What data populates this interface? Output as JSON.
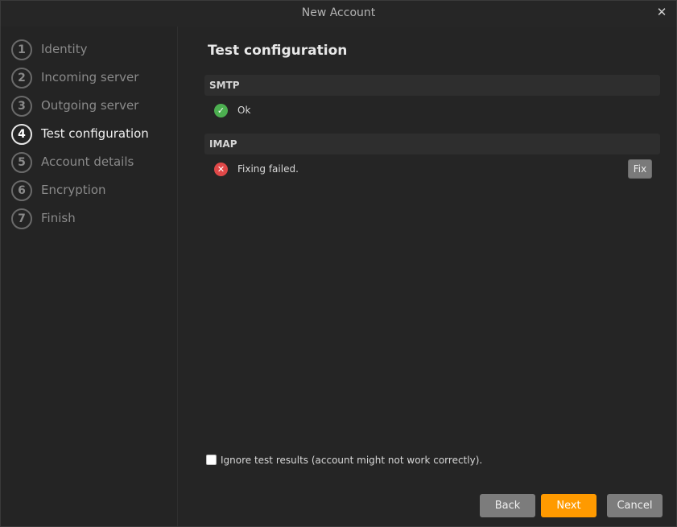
{
  "window": {
    "title": "New Account"
  },
  "steps": [
    {
      "number": "1",
      "label": "Identity"
    },
    {
      "number": "2",
      "label": "Incoming server"
    },
    {
      "number": "3",
      "label": "Outgoing server"
    },
    {
      "number": "4",
      "label": "Test configuration"
    },
    {
      "number": "5",
      "label": "Account details"
    },
    {
      "number": "6",
      "label": "Encryption"
    },
    {
      "number": "7",
      "label": "Finish"
    }
  ],
  "active_step": 3,
  "main": {
    "title": "Test configuration",
    "smtp": {
      "header": "SMTP",
      "status_text": "Ok",
      "status": "ok"
    },
    "imap": {
      "header": "IMAP",
      "status_text": "Fixing failed.",
      "status": "failed",
      "fix_label": "Fix"
    },
    "ignore_label": "Ignore test results (account might not work correctly).",
    "ignore_checked": false
  },
  "buttons": {
    "back": "Back",
    "next": "Next",
    "cancel": "Cancel"
  },
  "colors": {
    "accent": "#ff9a00",
    "ok": "#4caf50",
    "error": "#e04848"
  }
}
